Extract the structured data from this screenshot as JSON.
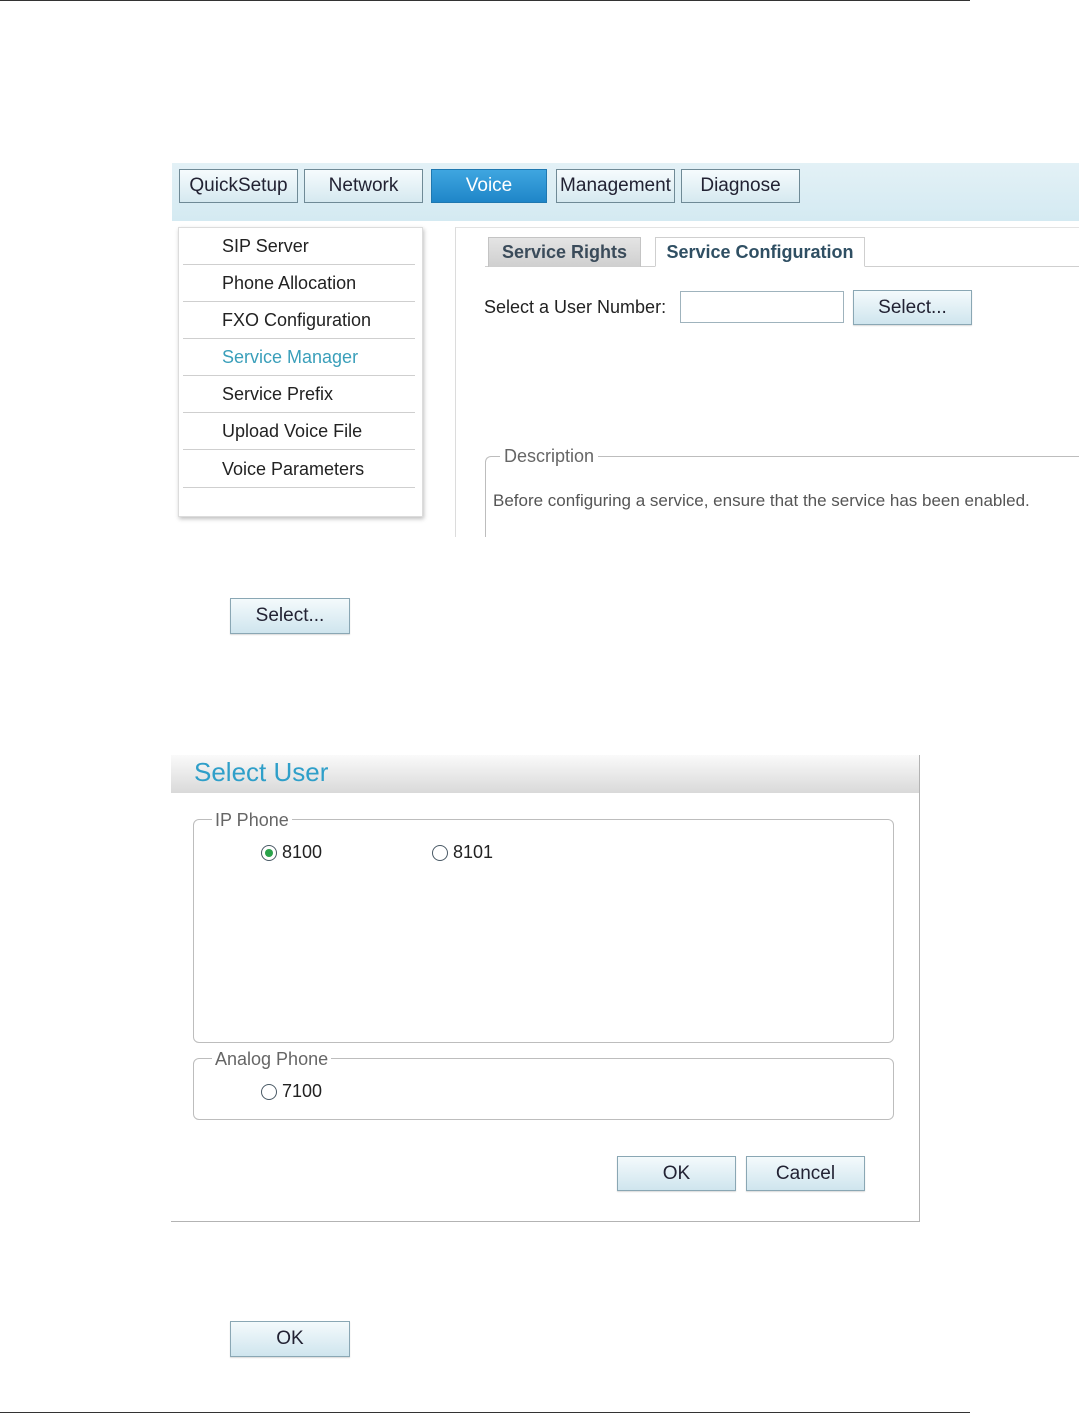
{
  "nav": {
    "items": [
      "QuickSetup",
      "Network",
      "Voice",
      "Management",
      "Diagnose"
    ],
    "active": "Voice"
  },
  "sidebar": {
    "items": [
      "SIP Server",
      "Phone Allocation",
      "FXO Configuration",
      "Service Manager",
      "Service Prefix",
      "Upload Voice File",
      "Voice Parameters"
    ],
    "active": "Service Manager"
  },
  "tabs": {
    "service_rights": "Service Rights",
    "service_configuration": "Service Configuration"
  },
  "form": {
    "user_number_label": "Select a User Number:",
    "user_number_value": "",
    "select_button": "Select..."
  },
  "description": {
    "legend": "Description",
    "text": "Before configuring a service, ensure that the service has been enabled."
  },
  "standalone_select_button": "Select...",
  "dialog": {
    "title": "Select User",
    "ip_phone": {
      "legend": "IP Phone",
      "options": [
        {
          "label": "8100",
          "checked": true
        },
        {
          "label": "8101",
          "checked": false
        }
      ]
    },
    "analog_phone": {
      "legend": "Analog Phone",
      "options": [
        {
          "label": "7100",
          "checked": false
        }
      ]
    },
    "ok_button": "OK",
    "cancel_button": "Cancel"
  },
  "standalone_ok_button": "OK",
  "colors": {
    "accent": "#2f9fc9",
    "active_nav": "#2a92d2",
    "active_sidebar": "#3a9fba",
    "radio_checked": "#2aa24a"
  }
}
